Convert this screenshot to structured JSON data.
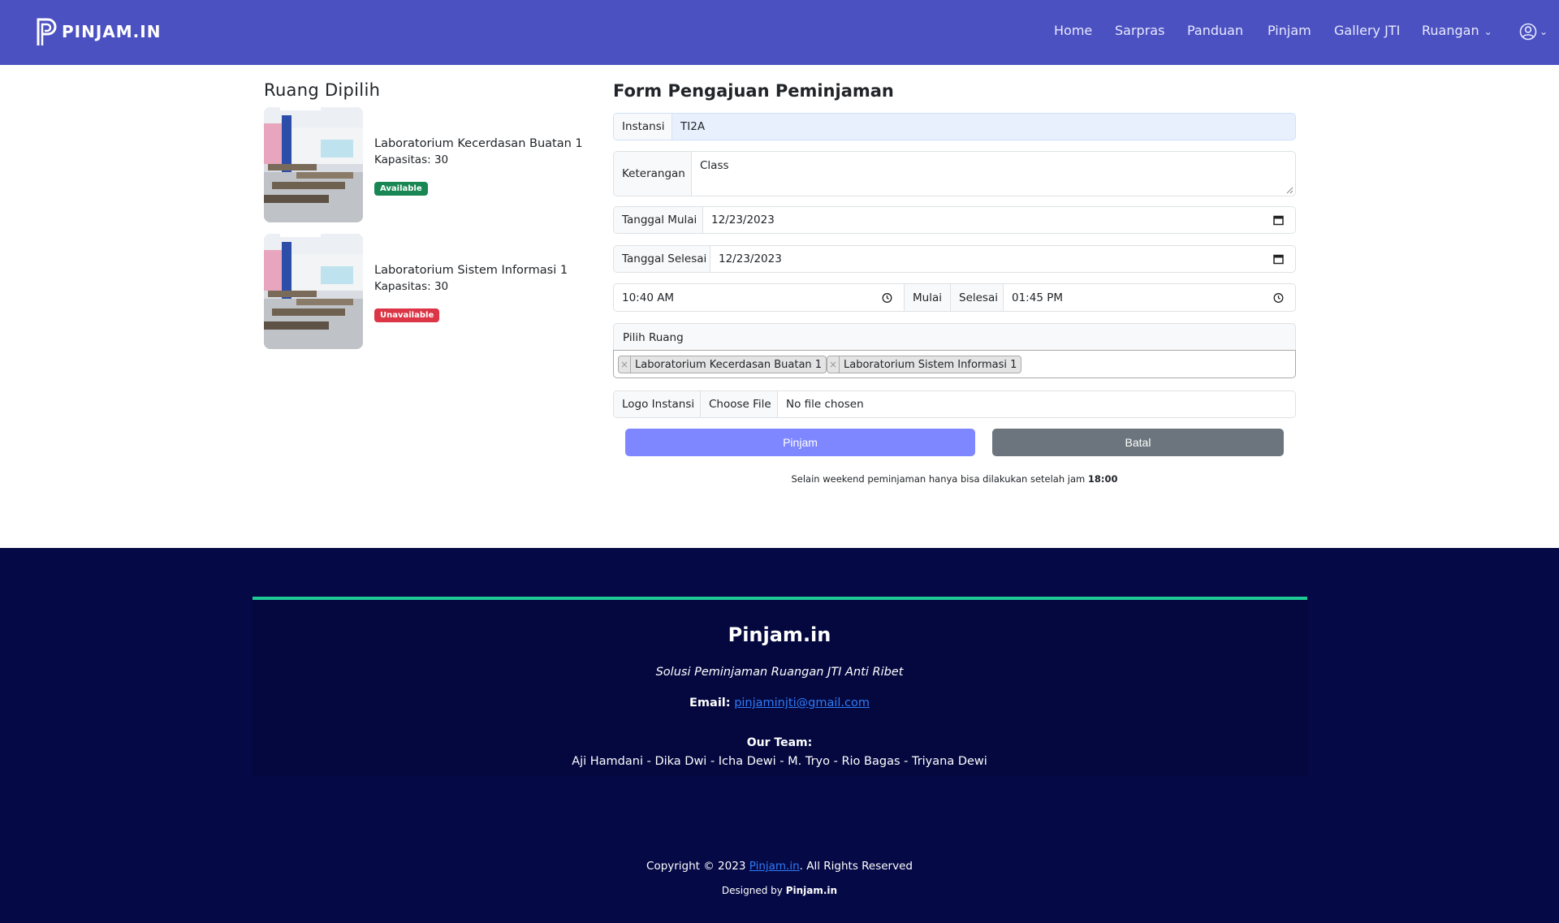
{
  "brand": {
    "name": "PINJAM.IN"
  },
  "nav": {
    "items": [
      {
        "label": "Home"
      },
      {
        "label": "Sarpras"
      },
      {
        "label": "Panduan"
      },
      {
        "label": "Pinjam"
      },
      {
        "label": "Gallery JTI"
      },
      {
        "label": "Ruangan"
      }
    ],
    "user_icon": "user-circle-icon"
  },
  "selected_rooms": {
    "title": "Ruang Dipilih",
    "rooms": [
      {
        "name": "Laboratorium Kecerdasan Buatan 1",
        "capacity": "Kapasitas: 30",
        "status": "Available",
        "status_color": "#198754"
      },
      {
        "name": "Laboratorium Sistem Informasi 1",
        "capacity": "Kapasitas: 30",
        "status": "Unavailable",
        "status_color": "#dc3545"
      }
    ]
  },
  "form": {
    "title": "Form Pengajuan Peminjaman",
    "instansi": {
      "label": "Instansi",
      "value": "TI2A"
    },
    "keterangan": {
      "label": "Keterangan",
      "value": "Class"
    },
    "tanggal_mulai": {
      "label": "Tanggal Mulai",
      "value": "12/23/2023"
    },
    "tanggal_selesai": {
      "label": "Tanggal Selesai",
      "value": "12/23/2023"
    },
    "waktu": {
      "start_value": "10:40 AM",
      "mulai_label": "Mulai",
      "selesai_label": "Selesai",
      "end_value": "01:45 PM"
    },
    "pilih_ruang": {
      "label": "Pilih Ruang",
      "selected": [
        "Laboratorium Kecerdasan Buatan 1",
        "Laboratorium Sistem Informasi 1"
      ]
    },
    "logo_instansi": {
      "label": "Logo Instansi",
      "button": "Choose File",
      "file_status": "No file chosen"
    },
    "submit_label": "Pinjam",
    "cancel_label": "Batal",
    "note": {
      "text": "Selain weekend peminjaman hanya bisa dilakukan setelah jam",
      "time": "18:00"
    }
  },
  "footer": {
    "title": "Pinjam.in",
    "tagline": "Solusi Peminjaman Ruangan JTI Anti Ribet",
    "email_label": "Email:",
    "email": "pinjaminjti@gmail.com",
    "team_label": "Our Team:",
    "team": "Aji Hamdani - Dika Dwi - Icha Dewi - M. Tryo - Rio Bagas - Triyana Dewi",
    "copyright_prefix": "Copyright © 2023",
    "copyright_link": "Pinjam.in",
    "copyright_suffix": ". All Rights Reserved",
    "designed_prefix": "Designed by",
    "designed_by": "Pinjam.in"
  },
  "colors": {
    "navbar": "#4b51c0",
    "primary_button": "#7e87ff",
    "secondary_button": "#6c757d",
    "footer_bg": "#050945",
    "footer_accent": "#1fc995"
  }
}
